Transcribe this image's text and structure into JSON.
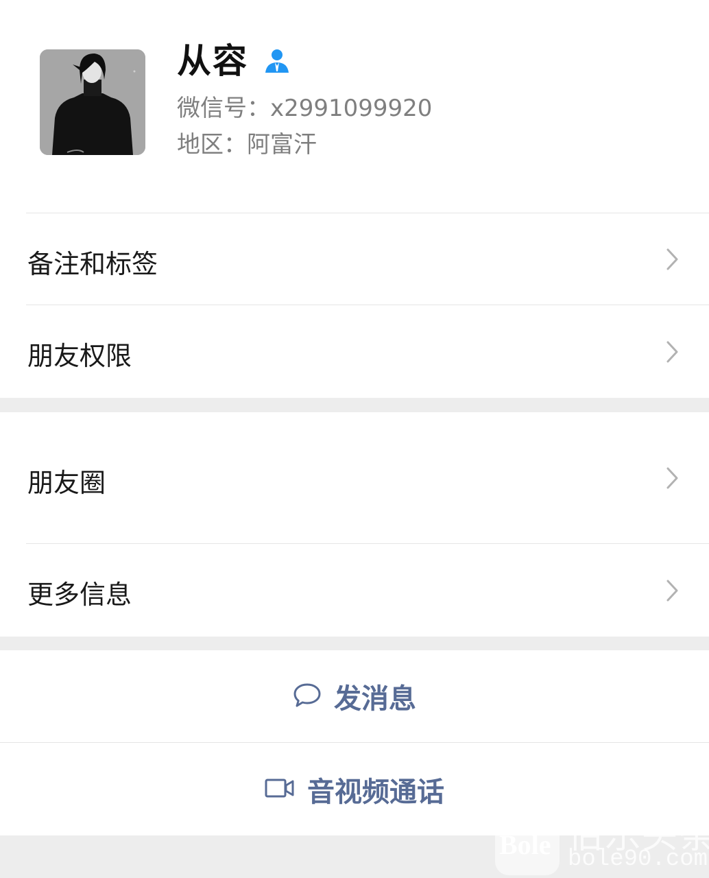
{
  "profile": {
    "name": "从容",
    "wechat_id": "微信号：x2991099920",
    "region": "地区：阿富汗",
    "gender_icon": "person-icon",
    "avatar": "avatar-portrait"
  },
  "settings": {
    "remarks_label": "备注和标签",
    "permissions_label": "朋友权限",
    "moments_label": "朋友圈",
    "more_info_label": "更多信息"
  },
  "actions": {
    "message_label": "发消息",
    "call_label": "音视频通话"
  },
  "watermark": {
    "badge": "Bole",
    "name": "伯乐头条",
    "url": "bole90.com"
  },
  "colors": {
    "link_blue": "#576b95",
    "gender_blue": "#2196f3",
    "background_gray": "#ededed"
  }
}
